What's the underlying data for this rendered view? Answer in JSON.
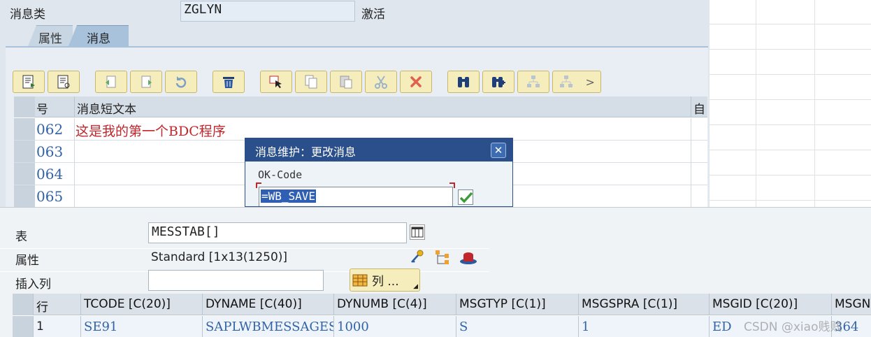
{
  "header": {
    "message_class_label": "消息类",
    "message_class_value": "ZGLYN",
    "status": "激活"
  },
  "tabs": [
    {
      "label": "属性",
      "active": false
    },
    {
      "label": "消息",
      "active": true
    }
  ],
  "messages_table": {
    "columns": [
      "号",
      "消息短文本",
      "自"
    ],
    "rows": [
      {
        "number": "062",
        "text": "这是我的第一个BDC程序"
      },
      {
        "number": "063",
        "text": ""
      },
      {
        "number": "064",
        "text": ""
      },
      {
        "number": "065",
        "text": ""
      }
    ]
  },
  "toolbar": {
    "icons": [
      "detail-icon",
      "detail-view-icon",
      "undo-icon",
      "redo-icon",
      "refresh-icon",
      "delete-icon",
      "select-icon",
      "copy-icon",
      "paste-icon",
      "cut-icon",
      "cancel-icon",
      "find-icon",
      "find-next-icon",
      "hierarchy-icon",
      "hierarchy-more-icon"
    ],
    "more_label": ">"
  },
  "dialog": {
    "title": "消息维护：更改消息",
    "okcode_label": "OK-Code",
    "okcode_value": "=WB_SAVE"
  },
  "debugger": {
    "table_label": "表",
    "table_value": "MESSTAB[]",
    "attr_label": "属性",
    "attr_value": "Standard [1x13(1250)]",
    "insert_col_label": "插入列",
    "insert_col_value": "",
    "columns_button": "列 ...",
    "grid": {
      "headers": [
        "行",
        "TCODE [C(20)]",
        "DYNAME [C(40)]",
        "DYNUMB [C(4)]",
        "MSGTYP [C(1)]",
        "MSGSPRA [C(1)]",
        "MSGID [C(20)]",
        "MSGN"
      ],
      "rows": [
        [
          "1",
          "SE91",
          "SAPLWBMESSAGES",
          "1000",
          "S",
          "1",
          "ED",
          "364"
        ]
      ]
    }
  },
  "watermark": "CSDN @xiao贱贱",
  "colors": {
    "accent_blue": "#3263a8",
    "dialog_title": "#2b4f8a",
    "red_text": "#c0262b",
    "toolbar_button": "#f6edbd"
  }
}
